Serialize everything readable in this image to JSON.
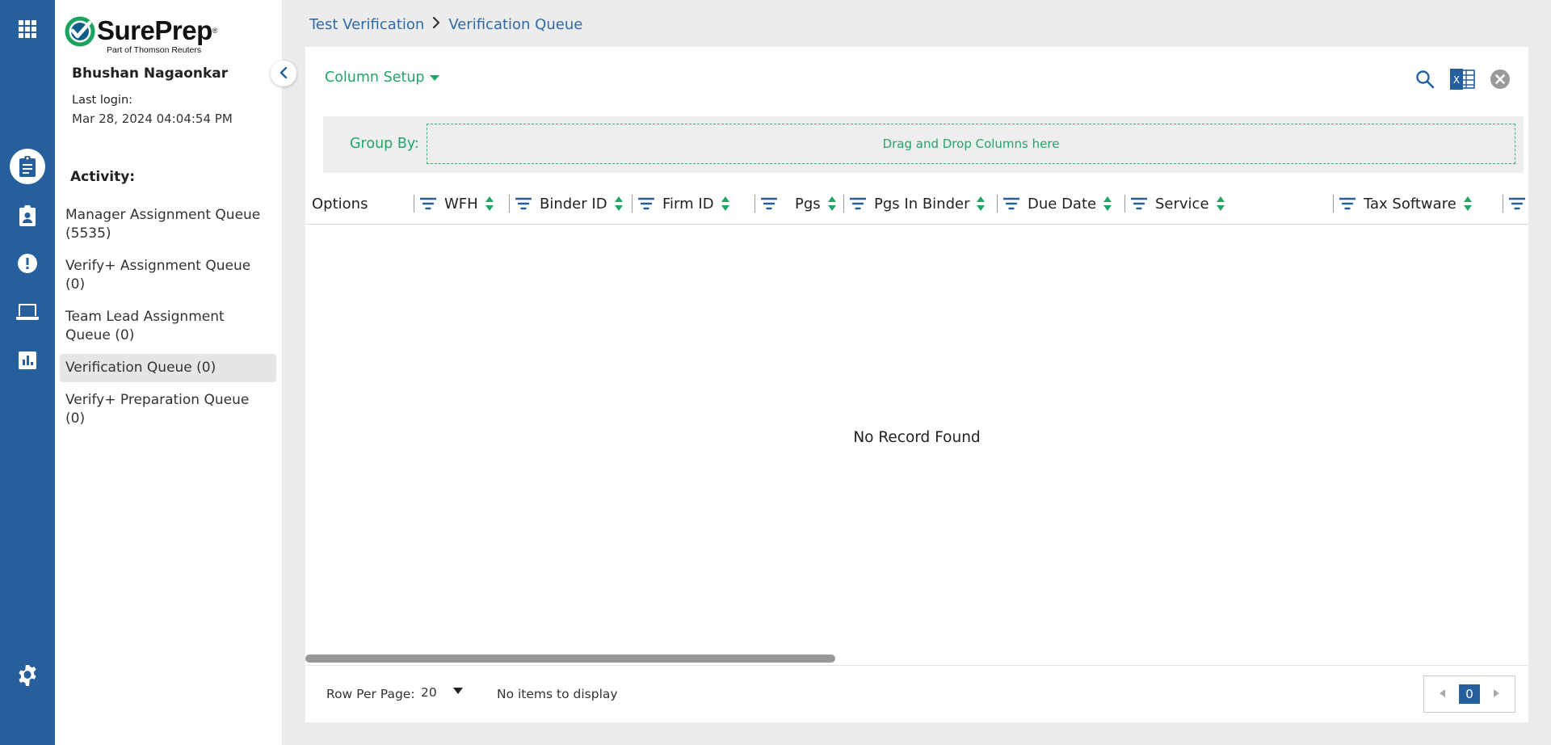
{
  "brand": {
    "name": "SurePrep",
    "registered": "®",
    "tagline": "Part of Thomson Reuters"
  },
  "user": {
    "name": "Bhushan Nagaonkar",
    "last_login_label": "Last login:",
    "last_login_value": "Mar 28, 2024 04:04:54 PM"
  },
  "activity": {
    "title": "Activity:",
    "items": [
      {
        "label": "Manager Assignment Queue (5535)"
      },
      {
        "label": "Verify+ Assignment Queue (0)"
      },
      {
        "label": "Team Lead Assignment Queue (0)"
      },
      {
        "label": "Verification Queue (0)"
      },
      {
        "label": "Verify+ Preparation Queue (0)"
      }
    ],
    "active_index": 3
  },
  "breadcrumb": {
    "parent": "Test Verification",
    "current": "Verification Queue"
  },
  "toolbar": {
    "column_setup": "Column Setup",
    "excel_letter": "X"
  },
  "group_by": {
    "label": "Group By:",
    "drop_hint": "Drag and Drop Columns here"
  },
  "table": {
    "columns": [
      "Options",
      "WFH",
      "Binder ID",
      "Firm ID",
      "Pgs",
      "Pgs In Binder",
      "Due Date",
      "Service",
      "Tax Software"
    ],
    "empty_message": "No Record Found"
  },
  "footer": {
    "rows_per_page_label": "Row Per Page:",
    "rows_per_page_value": "20",
    "items_message": "No items to display",
    "current_page": "0"
  },
  "colors": {
    "rail": "#255f9e",
    "accent_green": "#23a566",
    "link_blue": "#2f6aa8"
  }
}
